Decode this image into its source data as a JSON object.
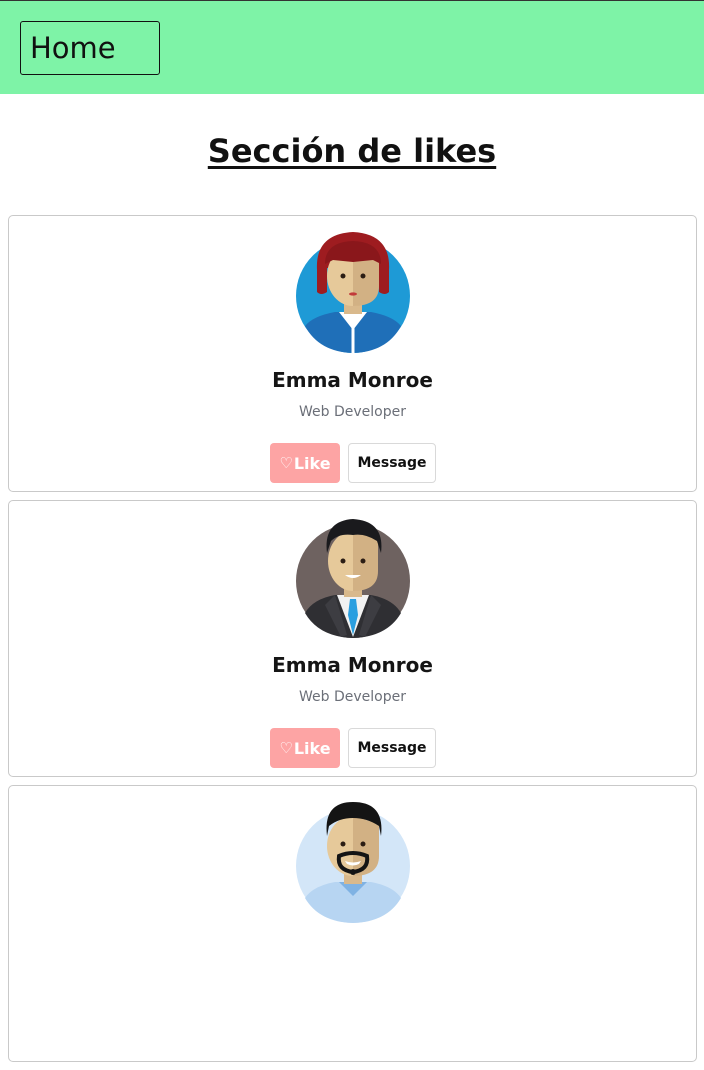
{
  "header": {
    "home_label": "Home",
    "background": "#7ef3a7"
  },
  "page": {
    "title": "Sección de likes"
  },
  "cards": [
    {
      "name": "Emma Monroe",
      "role": "Web Developer",
      "like_icon": "heart-icon",
      "like_label": "Like",
      "message_label": "Message",
      "avatar": "woman-red-hair-avatar"
    },
    {
      "name": "Emma Monroe",
      "role": "Web Developer",
      "like_icon": "heart-icon",
      "like_label": "Like",
      "message_label": "Message",
      "avatar": "man-suit-tie-avatar"
    },
    {
      "avatar": "man-goatee-avatar"
    }
  ],
  "colors": {
    "like_button": "#fda4a4",
    "role_text": "#6b6f78",
    "card_border": "#c9c9c9"
  }
}
